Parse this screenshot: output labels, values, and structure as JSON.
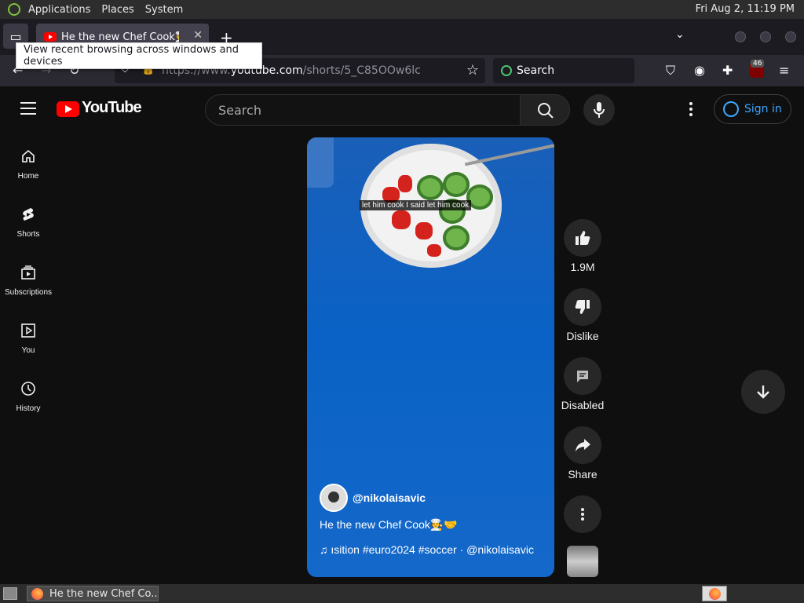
{
  "system_panel": {
    "menus": [
      "Applications",
      "Places",
      "System"
    ],
    "clock": "Fri Aug  2, 11:19 PM"
  },
  "browser": {
    "tab_title": "He the new Chef Cook🧑‍🍳🤝",
    "tooltip": "View recent browsing across windows and devices",
    "url_prefix": "https://www.",
    "url_host": "youtube.com",
    "url_path": "/shorts/5_C85OOw6lc",
    "search_placeholder": "Search",
    "ublock_badge": "46"
  },
  "youtube": {
    "wordmark": "YouTube",
    "search_placeholder": "Search",
    "signin_label": "Sign in",
    "sidebar": [
      {
        "label": "Home",
        "icon": "home-icon"
      },
      {
        "label": "Shorts",
        "icon": "shorts-icon"
      },
      {
        "label": "Subscriptions",
        "icon": "subscriptions-icon"
      },
      {
        "label": "You",
        "icon": "you-icon"
      },
      {
        "label": "History",
        "icon": "history-icon"
      }
    ],
    "short": {
      "caption_overlay": "let him cook I said let him cook",
      "channel": "@nikolaisavic",
      "title": "He the new Chef Cook🧑‍🍳🤝",
      "music_line": "ısition #euro2024 #soccer · @nikolaisavic"
    },
    "actions": {
      "likes": "1.9M",
      "dislike_label": "Dislike",
      "comments_label": "Disabled",
      "share_label": "Share"
    }
  },
  "taskbar": {
    "window_title": "He the new Chef Co..."
  },
  "colors": {
    "yt_red": "#ff0000",
    "signin_blue": "#3ea6ff",
    "video_blue": "#0a62c6"
  }
}
